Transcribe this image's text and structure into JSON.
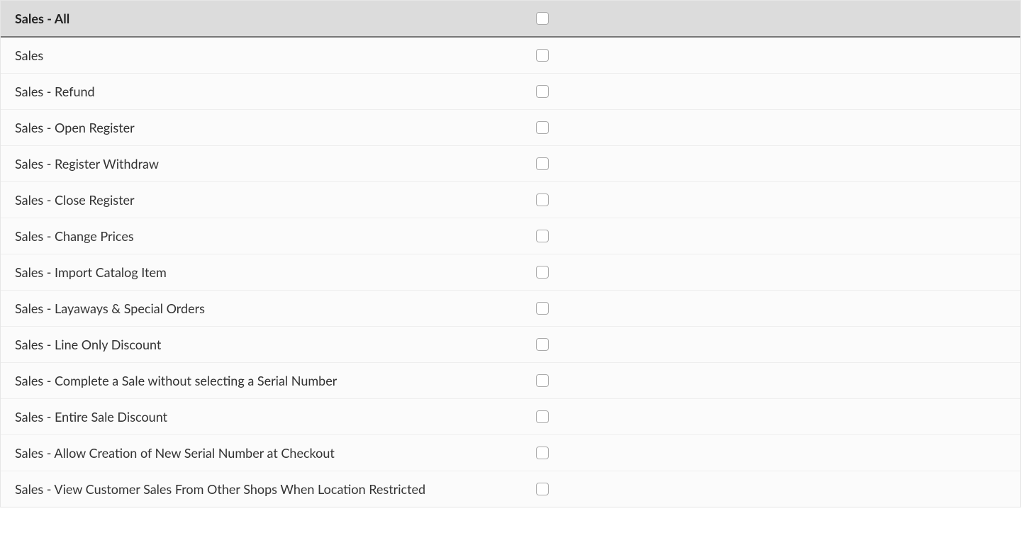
{
  "header": {
    "label": "Sales - All",
    "checked": false
  },
  "rows": [
    {
      "label": "Sales",
      "checked": false
    },
    {
      "label": "Sales - Refund",
      "checked": false
    },
    {
      "label": "Sales - Open Register",
      "checked": false
    },
    {
      "label": "Sales - Register Withdraw",
      "checked": false
    },
    {
      "label": "Sales - Close Register",
      "checked": false
    },
    {
      "label": "Sales - Change Prices",
      "checked": false
    },
    {
      "label": "Sales - Import Catalog Item",
      "checked": false
    },
    {
      "label": "Sales - Layaways & Special Orders",
      "checked": false
    },
    {
      "label": "Sales - Line Only Discount",
      "checked": false
    },
    {
      "label": "Sales - Complete a Sale without selecting a Serial Number",
      "checked": false
    },
    {
      "label": "Sales - Entire Sale Discount",
      "checked": false
    },
    {
      "label": "Sales - Allow Creation of New Serial Number at Checkout",
      "checked": false
    },
    {
      "label": "Sales - View Customer Sales From Other Shops When Location Restricted",
      "checked": false
    }
  ]
}
